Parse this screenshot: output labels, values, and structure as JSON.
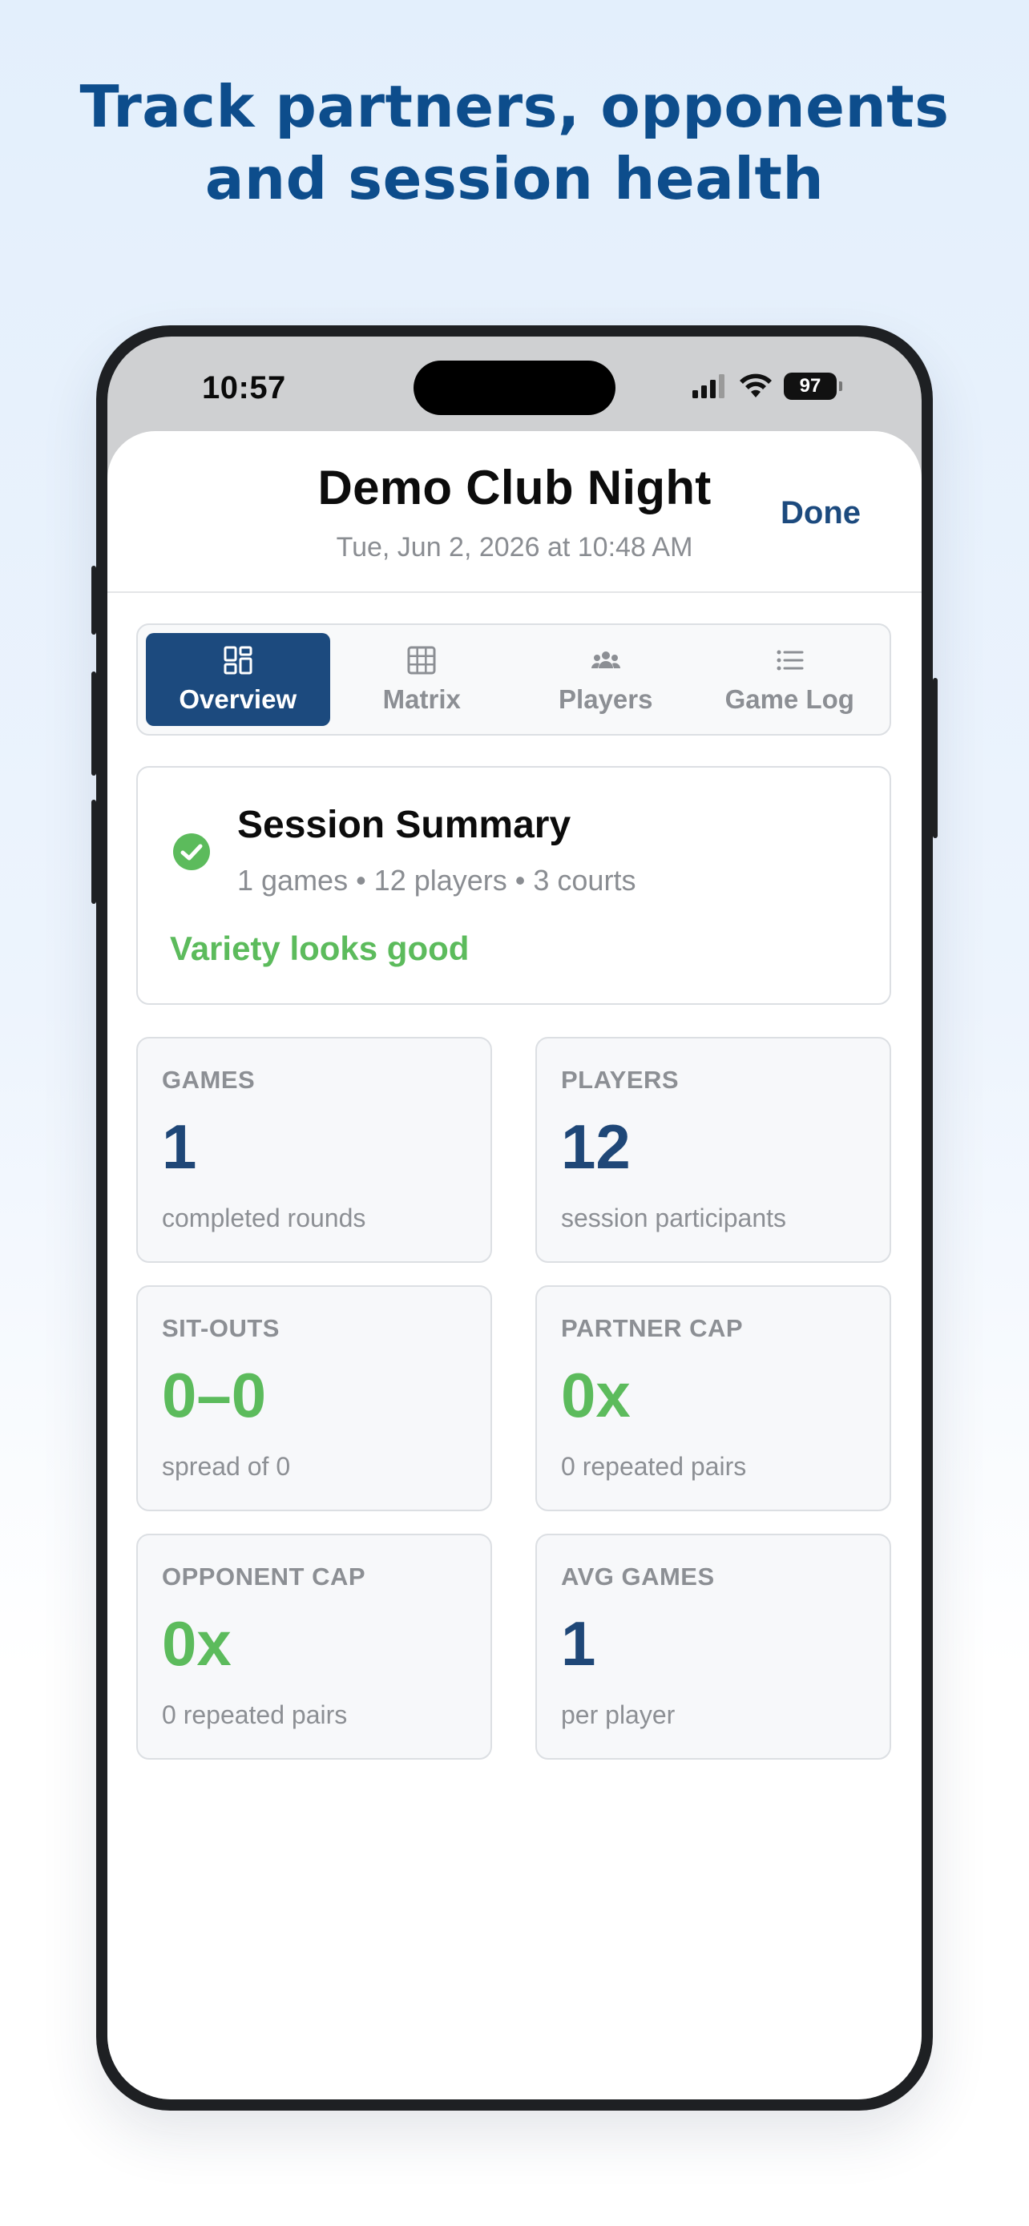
{
  "headline": {
    "line1": "Track partners, opponents",
    "line2": "and session health"
  },
  "status_bar": {
    "time": "10:57",
    "battery": "97",
    "signal_icon": "signal-bars-icon",
    "wifi_icon": "wifi-icon"
  },
  "sheet": {
    "title": "Demo Club Night",
    "subtitle": "Tue, Jun 2, 2026 at 10:48 AM",
    "done_label": "Done"
  },
  "tabs": [
    {
      "label": "Overview",
      "icon": "grid-dashboard-icon",
      "active": true
    },
    {
      "label": "Matrix",
      "icon": "table-grid-icon",
      "active": false
    },
    {
      "label": "Players",
      "icon": "people-icon",
      "active": false
    },
    {
      "label": "Game Log",
      "icon": "list-icon",
      "active": false
    }
  ],
  "summary": {
    "title": "Session Summary",
    "meta": "1 games • 12 players • 3 courts",
    "status": "Variety looks good",
    "icon": "check-circle-icon"
  },
  "stats": [
    {
      "label": "GAMES",
      "value": "1",
      "note": "completed rounds",
      "color": "blue"
    },
    {
      "label": "PLAYERS",
      "value": "12",
      "note": "session participants",
      "color": "blue"
    },
    {
      "label": "SIT-OUTS",
      "value": "0–0",
      "note": "spread of 0",
      "color": "green"
    },
    {
      "label": "PARTNER CAP",
      "value": "0x",
      "note": "0 repeated pairs",
      "color": "green"
    },
    {
      "label": "OPPONENT CAP",
      "value": "0x",
      "note": "0 repeated pairs",
      "color": "green"
    },
    {
      "label": "AVG GAMES",
      "value": "1",
      "note": "per player",
      "color": "blue"
    }
  ],
  "colors": {
    "brand_blue": "#1c4a7e",
    "headline_blue": "#0d4d8c",
    "success_green": "#5cbb5c"
  }
}
